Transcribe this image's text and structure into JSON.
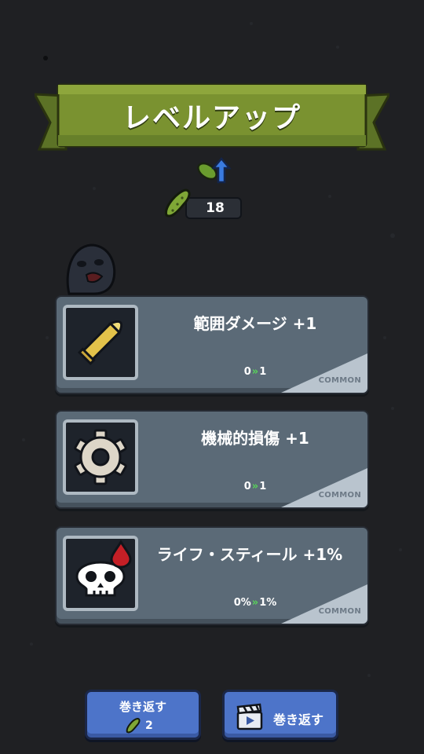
{
  "header": {
    "title": "レベルアップ",
    "pickle_count": "18"
  },
  "colors": {
    "banner": "#7a9230",
    "card": "#5b6a77",
    "button": "#4d74c9",
    "progress_arrow": "#58d25a"
  },
  "cards": [
    {
      "title": "範囲ダメージ +1",
      "from": "0",
      "to": "1",
      "rarity": "COMMON",
      "icon": "bullet-icon"
    },
    {
      "title": "機械的損傷 +1",
      "from": "0",
      "to": "1",
      "rarity": "COMMON",
      "icon": "gear-icon"
    },
    {
      "title": "ライフ・スティール +1%",
      "from": "0%",
      "to": "1%",
      "rarity": "COMMON",
      "icon": "bleeding-skull-icon"
    }
  ],
  "buttons": {
    "reroll_label": "巻き返す",
    "reroll_cost": "2",
    "ad_reroll_label": "巻き返す"
  }
}
